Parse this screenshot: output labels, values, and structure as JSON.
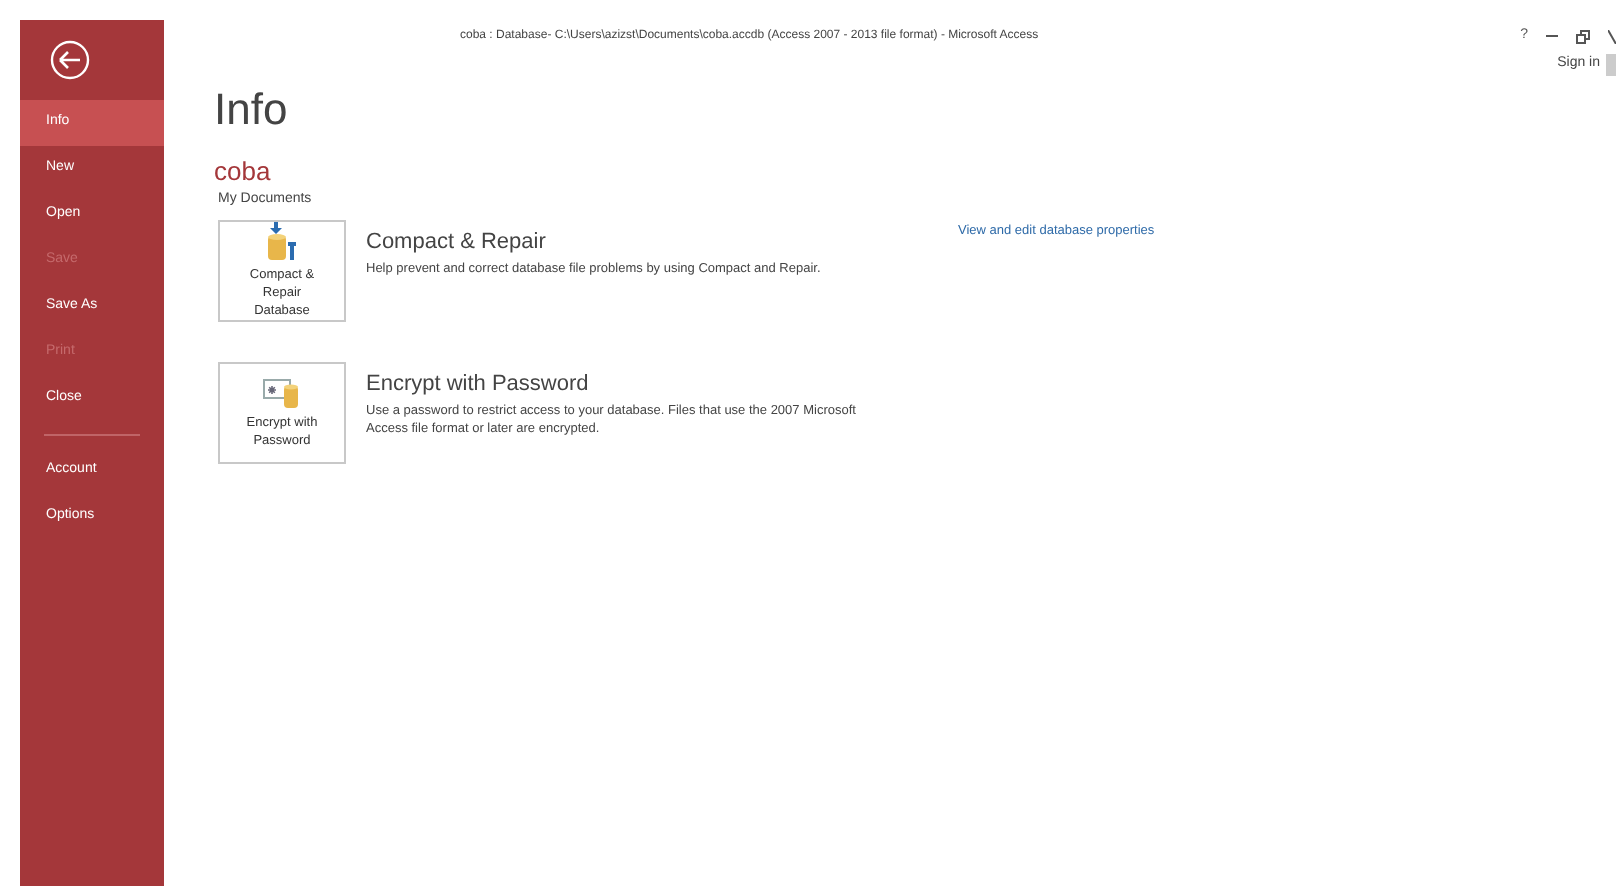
{
  "window": {
    "title": "coba : Database- C:\\Users\\azizst\\Documents\\coba.accdb (Access 2007 - 2013 file format) - Microsoft Access",
    "help": "?",
    "sign_in": "Sign in"
  },
  "sidebar": {
    "items": [
      {
        "label": "Info",
        "selected": true,
        "disabled": false
      },
      {
        "label": "New",
        "selected": false,
        "disabled": false
      },
      {
        "label": "Open",
        "selected": false,
        "disabled": false
      },
      {
        "label": "Save",
        "selected": false,
        "disabled": true
      },
      {
        "label": "Save As",
        "selected": false,
        "disabled": false
      },
      {
        "label": "Print",
        "selected": false,
        "disabled": true
      },
      {
        "label": "Close",
        "selected": false,
        "disabled": false
      }
    ],
    "footer_items": [
      {
        "label": "Account",
        "selected": false
      },
      {
        "label": "Options",
        "selected": false
      }
    ]
  },
  "page": {
    "title": "Info",
    "file_name": "coba",
    "location": "My Documents",
    "properties_link": "View and edit database properties",
    "actions": [
      {
        "kind": "compact",
        "button": "Compact & Repair Database",
        "title": "Compact & Repair",
        "description": "Help prevent and correct database file problems by using Compact and Repair."
      },
      {
        "kind": "encrypt",
        "button": "Encrypt with Password",
        "title": "Encrypt with Password",
        "description": "Use a password to restrict access to your database. Files that use the 2007 Microsoft Access file format or later are encrypted."
      }
    ]
  }
}
